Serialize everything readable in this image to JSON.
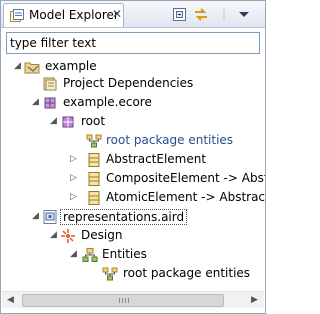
{
  "view": {
    "title": "Model Explorer",
    "close_glyph": "✕",
    "icon": "model-explorer-icon"
  },
  "toolbar": {
    "buttons": [
      "collapse-all-icon",
      "link-with-editor-icon",
      "view-menu-icon"
    ]
  },
  "filter": {
    "placeholder": "type filter text",
    "value": ""
  },
  "tree": {
    "items": [
      {
        "label": "example",
        "icon": "project-icon",
        "expanded": true
      },
      {
        "label": "Project Dependencies",
        "icon": "dependencies-icon"
      },
      {
        "label": "example.ecore",
        "icon": "ecore-file-icon",
        "expanded": true
      },
      {
        "label": "root",
        "icon": "epackage-icon",
        "expanded": true
      },
      {
        "label": "root package entities",
        "icon": "diagram-icon"
      },
      {
        "label": "AbstractElement",
        "icon": "eclass-icon",
        "expanded": false
      },
      {
        "label": "CompositeElement -> AbstractEleme",
        "icon": "eclass-icon",
        "expanded": false
      },
      {
        "label": "AtomicElement -> AbstractElement",
        "icon": "eclass-icon",
        "expanded": false
      },
      {
        "label": "representations.aird",
        "icon": "aird-file-icon",
        "expanded": true,
        "selected": true
      },
      {
        "label": "Design",
        "icon": "viewpoint-icon",
        "expanded": true
      },
      {
        "label": "Entities",
        "icon": "representation-icon",
        "expanded": true
      },
      {
        "label": "root package entities",
        "icon": "diagram-icon"
      }
    ]
  },
  "scrollbar": {
    "left_arrow": "◀",
    "right_arrow": "▶"
  },
  "colors": {
    "link_blue": "#2a4c8e",
    "title_gradient_top": "#f7f9fc",
    "title_gradient_bottom": "#dfe6f0",
    "border": "#99a4b4"
  }
}
